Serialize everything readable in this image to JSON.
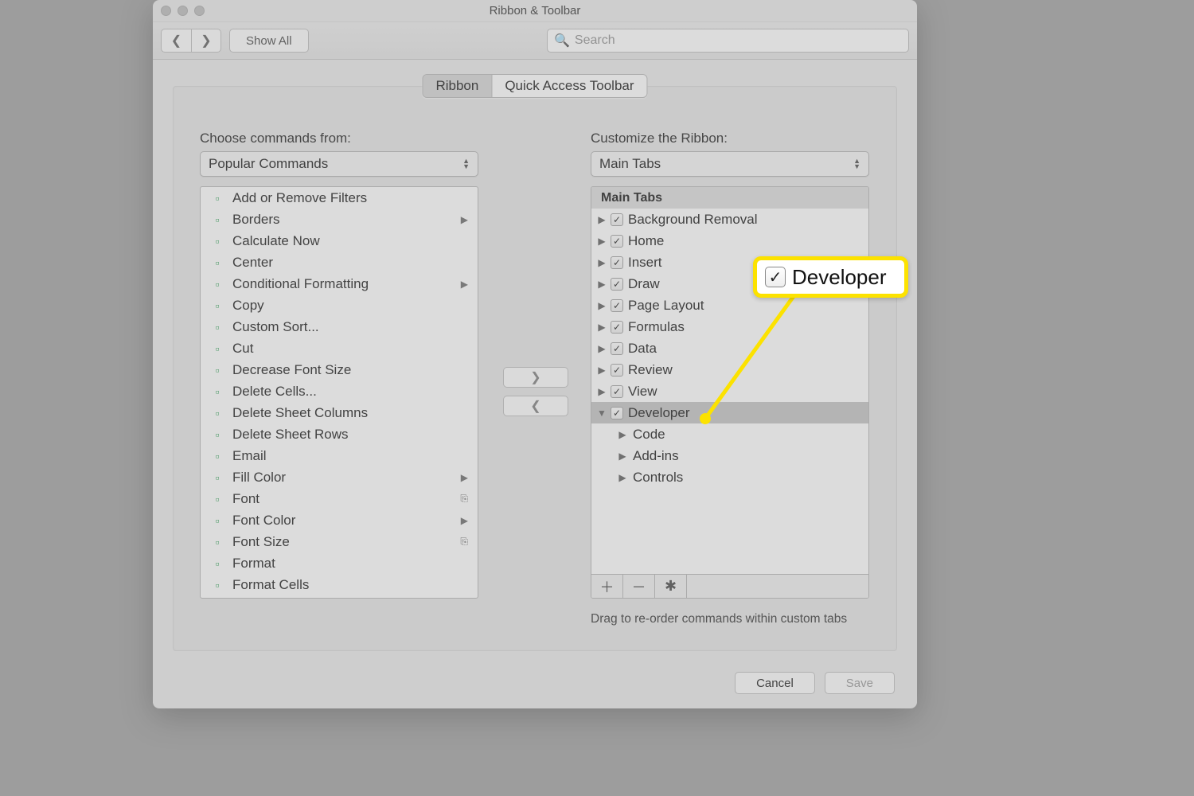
{
  "window": {
    "title": "Ribbon & Toolbar"
  },
  "toolbar": {
    "show_all": "Show All",
    "search_placeholder": "Search"
  },
  "tabs": {
    "ribbon": "Ribbon",
    "qat": "Quick Access Toolbar"
  },
  "left": {
    "label": "Choose commands from:",
    "popup": "Popular Commands",
    "items": [
      {
        "label": "Add or Remove Filters",
        "sub": ""
      },
      {
        "label": "Borders",
        "sub": "▶"
      },
      {
        "label": "Calculate Now",
        "sub": ""
      },
      {
        "label": "Center",
        "sub": ""
      },
      {
        "label": "Conditional Formatting",
        "sub": "▶"
      },
      {
        "label": "Copy",
        "sub": ""
      },
      {
        "label": "Custom Sort...",
        "sub": ""
      },
      {
        "label": "Cut",
        "sub": ""
      },
      {
        "label": "Decrease Font Size",
        "sub": ""
      },
      {
        "label": "Delete Cells...",
        "sub": ""
      },
      {
        "label": "Delete Sheet Columns",
        "sub": ""
      },
      {
        "label": "Delete Sheet Rows",
        "sub": ""
      },
      {
        "label": "Email",
        "sub": ""
      },
      {
        "label": "Fill Color",
        "sub": "▶"
      },
      {
        "label": "Font",
        "sub": "⎘"
      },
      {
        "label": "Font Color",
        "sub": "▶"
      },
      {
        "label": "Font Size",
        "sub": "⎘"
      },
      {
        "label": "Format",
        "sub": ""
      },
      {
        "label": "Format Cells",
        "sub": ""
      }
    ]
  },
  "right": {
    "label": "Customize the Ribbon:",
    "popup": "Main Tabs",
    "header": "Main Tabs",
    "tabs": [
      {
        "label": "Background Removal",
        "checked": true,
        "expanded": false
      },
      {
        "label": "Home",
        "checked": true,
        "expanded": false
      },
      {
        "label": "Insert",
        "checked": true,
        "expanded": false
      },
      {
        "label": "Draw",
        "checked": true,
        "expanded": false
      },
      {
        "label": "Page Layout",
        "checked": true,
        "expanded": false
      },
      {
        "label": "Formulas",
        "checked": true,
        "expanded": false
      },
      {
        "label": "Data",
        "checked": true,
        "expanded": false
      },
      {
        "label": "Review",
        "checked": true,
        "expanded": false
      },
      {
        "label": "View",
        "checked": true,
        "expanded": false
      },
      {
        "label": "Developer",
        "checked": true,
        "expanded": true,
        "selected": true,
        "children": [
          {
            "label": "Code"
          },
          {
            "label": "Add-ins"
          },
          {
            "label": "Controls"
          }
        ]
      }
    ],
    "drag_hint": "Drag to re-order commands within custom tabs"
  },
  "callout": {
    "label": "Developer"
  },
  "buttons": {
    "cancel": "Cancel",
    "save": "Save"
  }
}
